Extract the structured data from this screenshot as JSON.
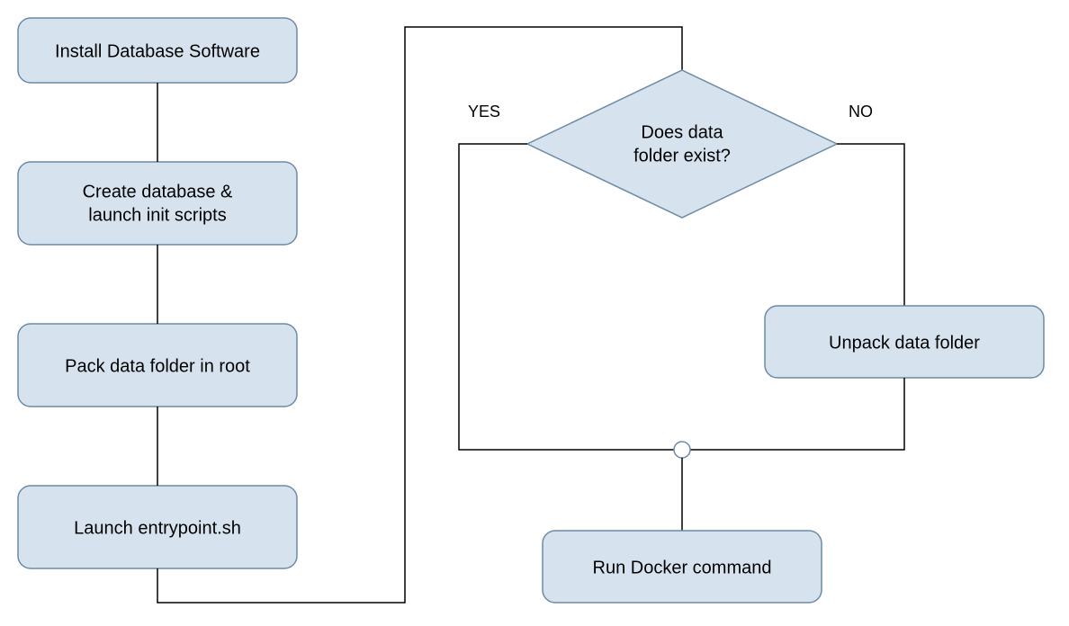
{
  "nodes": {
    "install": "Install Database Software",
    "create_l1": "Create database &",
    "create_l2": "launch init scripts",
    "pack": "Pack data folder in root",
    "launch": "Launch entrypoint.sh",
    "decision_l1": "Does data",
    "decision_l2": "folder exist?",
    "unpack": "Unpack data folder",
    "run": "Run Docker command"
  },
  "edges": {
    "yes": "YES",
    "no": "NO"
  },
  "colors": {
    "fill": "#d6e3ee",
    "stroke": "#6b8aa6"
  }
}
